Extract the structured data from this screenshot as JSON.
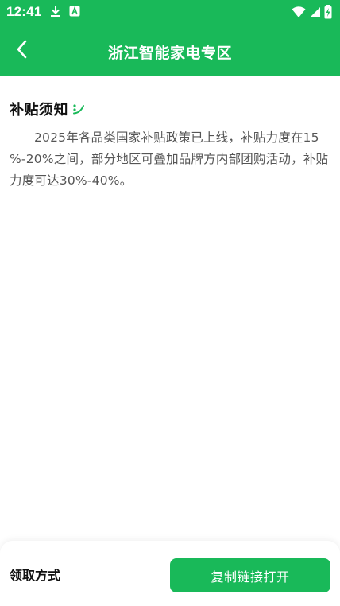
{
  "status_bar": {
    "time": "12:41",
    "left_icons": [
      "download-icon",
      "font-icon"
    ],
    "right_icons": [
      "wifi-icon",
      "cellular-signal-icon",
      "battery-charging-icon"
    ]
  },
  "header": {
    "title": "浙江智能家电专区",
    "back_icon": "chevron-left-icon",
    "background_color": "#19b959"
  },
  "notice": {
    "title": "补贴须知",
    "title_icon": "leaf-icon",
    "body": "2025年各品类国家补贴政策已上线，补贴力度在15 %-20%之间，部分地区可叠加品牌方内部团购活动，补贴力度可达30%-40%。"
  },
  "bottom_bar": {
    "label": "领取方式",
    "button_label": "复制链接打开",
    "button_color": "#19b959"
  }
}
